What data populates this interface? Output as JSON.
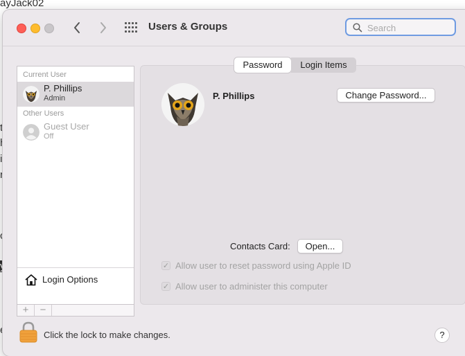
{
  "background": {
    "top_text": "ayJack02",
    "side_letters": [
      "t",
      "h",
      "i",
      "r",
      "c",
      "y",
      "e"
    ]
  },
  "window": {
    "title": "Users & Groups",
    "search": {
      "placeholder": "Search",
      "value": ""
    }
  },
  "sidebar": {
    "current_user_header": "Current User",
    "current_user": {
      "name": "P. Phillips",
      "role": "Admin"
    },
    "other_users_header": "Other Users",
    "other_user": {
      "name": "Guest User",
      "status": "Off"
    },
    "login_options_label": "Login Options",
    "add_label": "+",
    "remove_label": "−"
  },
  "tabs": [
    {
      "label": "Password",
      "active": true
    },
    {
      "label": "Login Items",
      "active": false
    }
  ],
  "main": {
    "user_name": "P. Phillips",
    "change_password_label": "Change Password...",
    "contacts_card_label": "Contacts Card:",
    "open_button_label": "Open...",
    "checkboxes": [
      {
        "label": "Allow user to reset password using Apple ID",
        "checked": true,
        "disabled": true
      },
      {
        "label": "Allow user to administer this computer",
        "checked": true,
        "disabled": true
      }
    ]
  },
  "footer": {
    "lock_text": "Click the lock to make changes.",
    "help_label": "?"
  },
  "colors": {
    "close": "#fe5f57",
    "minimize": "#febc2e",
    "zoom_disabled": "#c9c6c9",
    "focus_ring": "#6f9be2",
    "lock": "#f0a13c"
  }
}
